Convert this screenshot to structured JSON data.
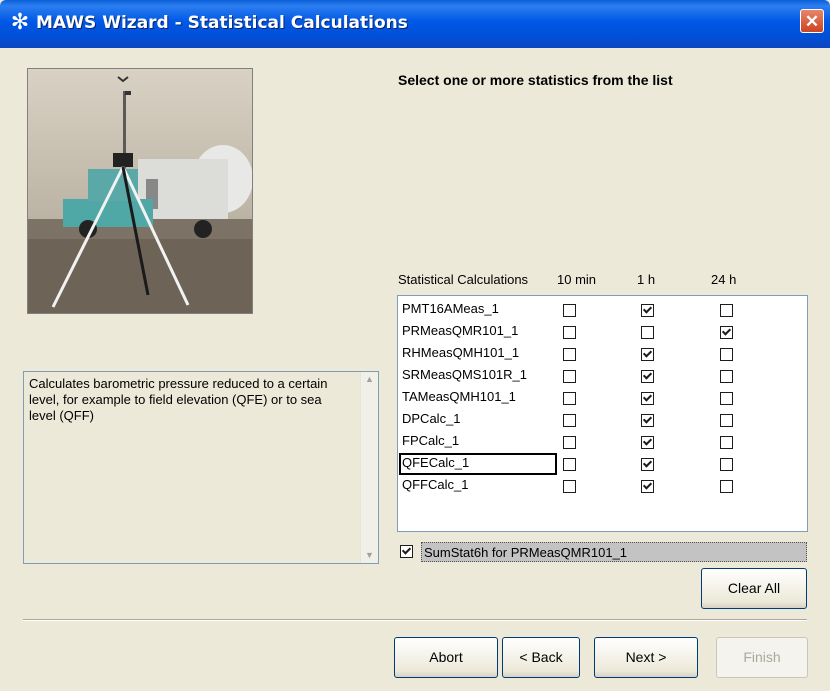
{
  "window": {
    "title": "MAWS Wizard - Statistical Calculations"
  },
  "description": "Calculates barometric pressure reduced to a certain level, for example to field elevation (QFE) or to sea level (QFF)",
  "heading": "Select one or more statistics from the list",
  "table": {
    "headers": [
      "Statistical Calculations",
      "10 min",
      "1 h",
      "24 h"
    ],
    "rows": [
      {
        "name": "PMT16AMeas_1",
        "min10": false,
        "h1": true,
        "h24": false
      },
      {
        "name": "PRMeasQMR101_1",
        "min10": false,
        "h1": false,
        "h24": true
      },
      {
        "name": "RHMeasQMH101_1",
        "min10": false,
        "h1": true,
        "h24": false
      },
      {
        "name": "SRMeasQMS101R_1",
        "min10": false,
        "h1": true,
        "h24": false
      },
      {
        "name": "TAMeasQMH101_1",
        "min10": false,
        "h1": true,
        "h24": false
      },
      {
        "name": "DPCalc_1",
        "min10": false,
        "h1": true,
        "h24": false
      },
      {
        "name": "FPCalc_1",
        "min10": false,
        "h1": true,
        "h24": false
      },
      {
        "name": "QFECalc_1",
        "min10": false,
        "h1": true,
        "h24": false
      },
      {
        "name": "QFFCalc_1",
        "min10": false,
        "h1": true,
        "h24": false
      }
    ]
  },
  "summary": {
    "label": "SumStat6h for PRMeasQMR101_1",
    "checked": true
  },
  "buttons": {
    "clear_all": "Clear All",
    "abort": "Abort",
    "back": "< Back",
    "next": "Next >",
    "finish": "Finish"
  },
  "colors": {
    "titlebar": "#0058e6",
    "window_bg": "#ece9d8",
    "close": "#cc4422"
  },
  "icons": {
    "title": "maws-wizard-icon",
    "close": "close-icon"
  }
}
